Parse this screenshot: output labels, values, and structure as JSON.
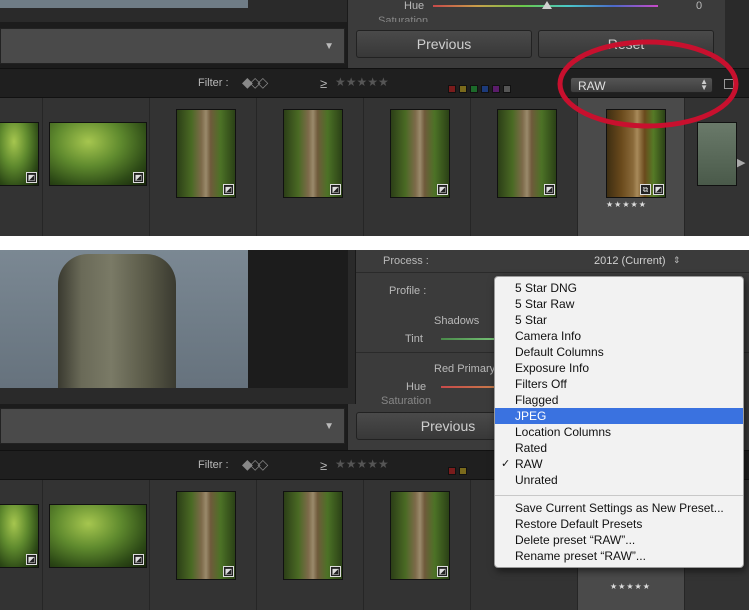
{
  "top": {
    "hue_label": "Hue",
    "hue_value": "0",
    "saturation_label": "Saturation",
    "previous_label": "Previous",
    "reset_label": "Reset",
    "filter_label": "Filter :",
    "gte_label": "≥",
    "preset_value": "RAW",
    "highlight_color": "#c8102e"
  },
  "bottom": {
    "process_label": "Process :",
    "process_value": "2012 (Current)",
    "profile_label": "Profile :",
    "shadows_label": "Shadows",
    "tint_label": "Tint",
    "red_primary_label": "Red Primary",
    "hue_label": "Hue",
    "saturation_label": "Saturation",
    "previous_label": "Previous",
    "filter_label": "Filter :",
    "gte_label": "≥"
  },
  "filmstrip": {
    "star_rating": "★★★★★"
  },
  "dropdown": {
    "items": [
      {
        "label": "5 Star DNG"
      },
      {
        "label": "5 Star Raw"
      },
      {
        "label": "5 Star"
      },
      {
        "label": "Camera Info"
      },
      {
        "label": "Default Columns"
      },
      {
        "label": "Exposure Info"
      },
      {
        "label": "Filters Off"
      },
      {
        "label": "Flagged"
      },
      {
        "label": "JPEG",
        "highlighted": true
      },
      {
        "label": "Location Columns"
      },
      {
        "label": "Rated"
      },
      {
        "label": "RAW",
        "checked": true
      },
      {
        "label": "Unrated"
      }
    ],
    "actions": [
      {
        "label": "Save Current Settings as New Preset..."
      },
      {
        "label": "Restore Default Presets"
      },
      {
        "label": "Delete preset “RAW”..."
      },
      {
        "label": "Rename preset “RAW”..."
      }
    ],
    "highlight_color": "#3a72e0"
  }
}
